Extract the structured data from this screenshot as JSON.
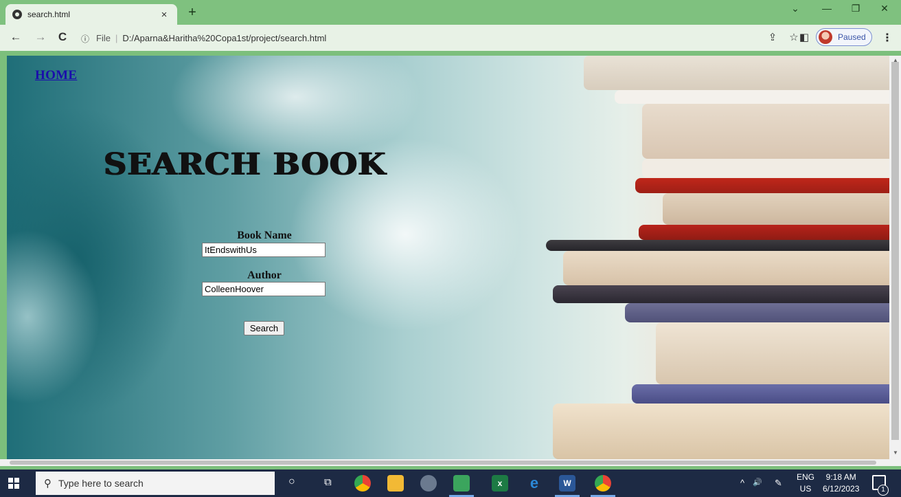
{
  "browser": {
    "tab": {
      "title": "search.html",
      "close_icon": "×"
    },
    "new_tab_icon": "+",
    "window_controls": {
      "dropdown": "⌄",
      "minimize": "—",
      "restore": "❐",
      "close": "✕"
    },
    "nav": {
      "back": "←",
      "forward": "→",
      "reload": "C"
    },
    "address": {
      "info_icon": "ⓘ",
      "scheme": "File",
      "separator": "|",
      "url": "D:/Aparna&Haritha%20Copa1st/project/search.html"
    },
    "toolbar_icons": {
      "share": "⇪",
      "bookmark": "☆",
      "sidepanel": "◧"
    },
    "profile": {
      "label": "Paused"
    },
    "menu": "⋮"
  },
  "page": {
    "home_link": "HOME",
    "title": "SEARCH BOOK",
    "form": {
      "book_name_label": "Book Name",
      "book_name_value": "ItEndswithUs",
      "author_label": "Author",
      "author_value": "ColleenHoover",
      "search_button": "Search"
    }
  },
  "taskbar": {
    "search_placeholder": "Type here to search",
    "search_icon": "⚲",
    "cortana_icon": "○",
    "taskview_icon": "⧉",
    "tray": {
      "chevron": "^",
      "volume": "🔊",
      "pen": "✎"
    },
    "lang_top": "ENG",
    "lang_bottom": "US",
    "time": "9:18 AM",
    "date": "6/12/2023",
    "notification_count": "1"
  },
  "colors": {
    "titlebar": "#7fc17f",
    "toolbar": "#e8f2e6",
    "link": "#1a0dab",
    "taskbar": "#1d2a44"
  }
}
